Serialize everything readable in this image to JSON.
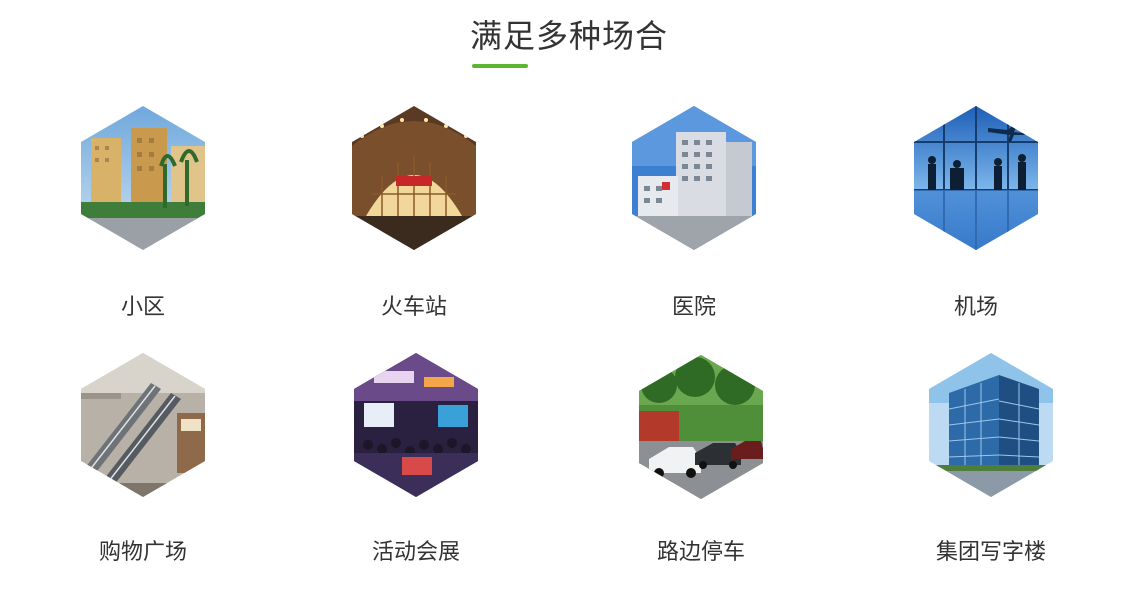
{
  "section": {
    "title": "满足多种场合",
    "accent_color": "#5cb531"
  },
  "scenarios": [
    {
      "label": "小区",
      "image": "residential-community-photo"
    },
    {
      "label": "火车站",
      "image": "train-station-photo"
    },
    {
      "label": "医院",
      "image": "hospital-photo"
    },
    {
      "label": "机场",
      "image": "airport-photo"
    },
    {
      "label": "购物广场",
      "image": "shopping-mall-photo"
    },
    {
      "label": "活动会展",
      "image": "exhibition-photo"
    },
    {
      "label": "路边停车",
      "image": "roadside-parking-photo"
    },
    {
      "label": "集团写字楼",
      "image": "office-building-photo"
    }
  ]
}
